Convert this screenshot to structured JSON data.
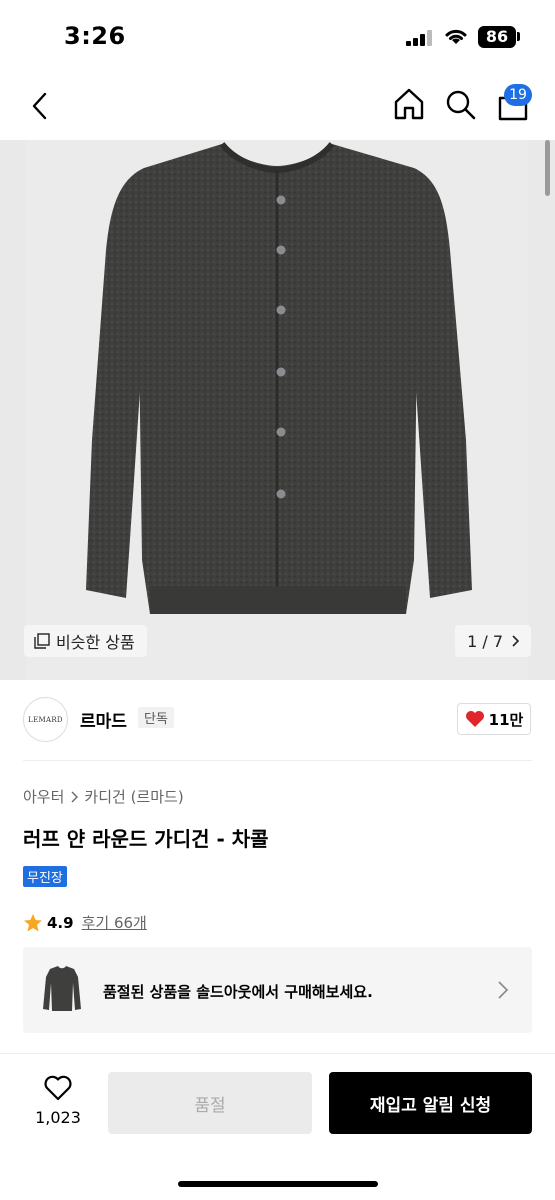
{
  "status_bar": {
    "time": "3:26",
    "battery": "86"
  },
  "nav": {
    "cart_count": "19"
  },
  "hero": {
    "similar_label": "비슷한 상품",
    "page_counter": "1 / 7"
  },
  "brand": {
    "logo_text": "LEMARD",
    "name": "르마드",
    "tag": "단독",
    "likes": "11만"
  },
  "product": {
    "breadcrumb": [
      "아우터",
      "카디건 (르마드)"
    ],
    "title": "러프 얀 라운드 가디건 - 차콜",
    "store_badge": "무진장",
    "rating": "4.9",
    "reviews": "후기 66개"
  },
  "soldout_banner": {
    "text": "품절된 상품을 솔드아웃에서 구매해보세요."
  },
  "bottom_bar": {
    "wish_count": "1,023",
    "sold_label": "품절",
    "restock_label": "재입고 알림 신청"
  },
  "colors": {
    "accent_blue": "#1e6fe6",
    "heart_red": "#e0262b"
  }
}
